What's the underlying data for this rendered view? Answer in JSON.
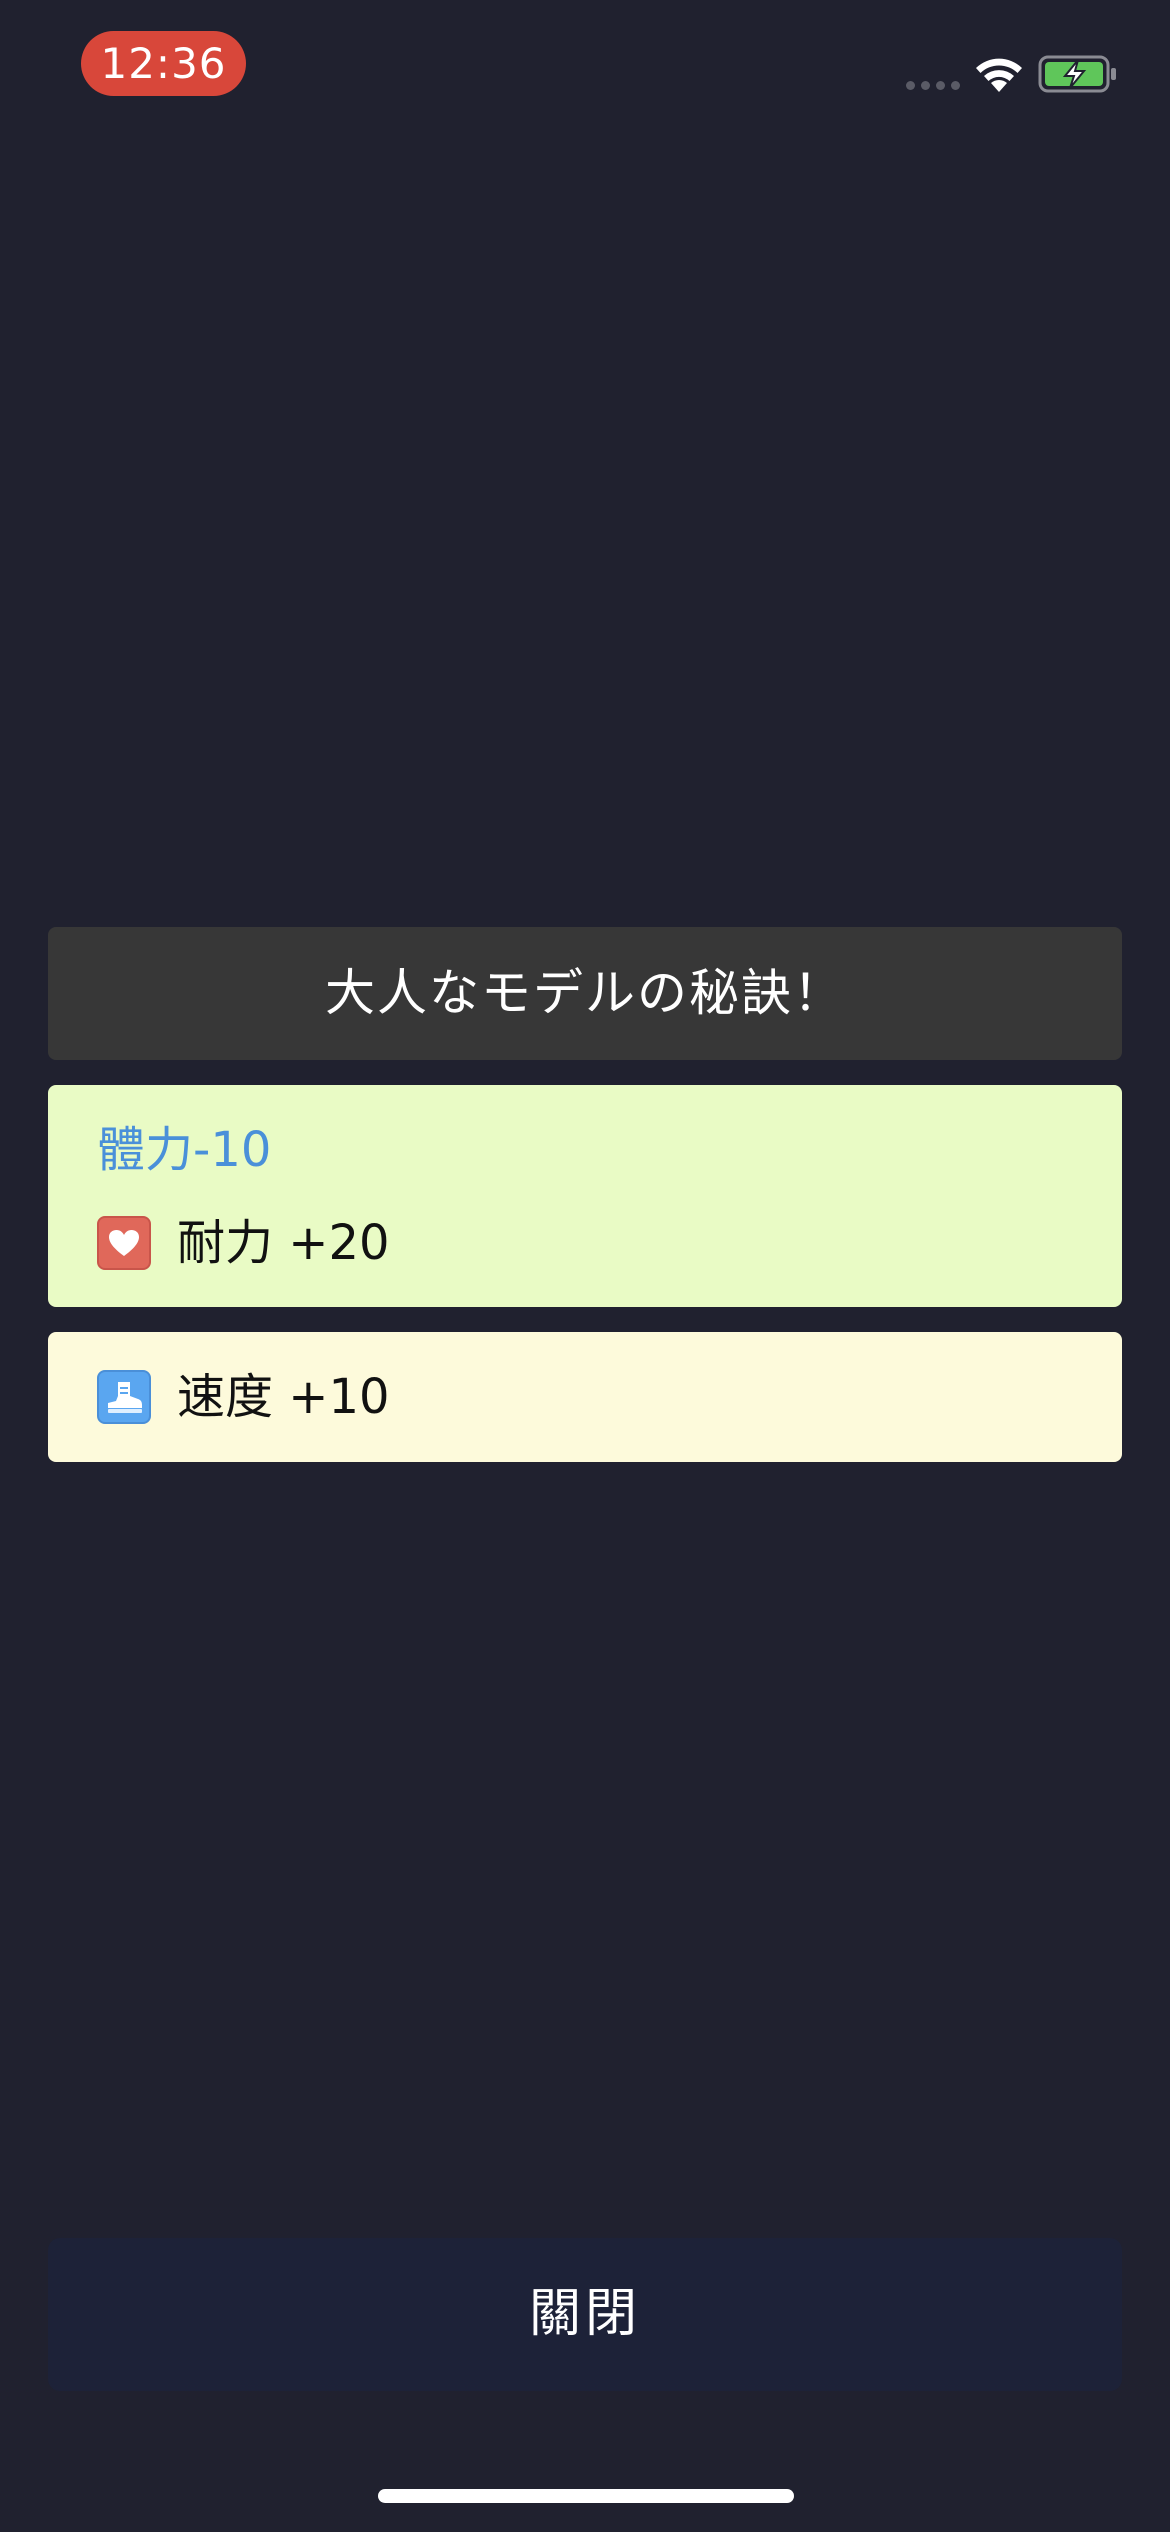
{
  "status_bar": {
    "time": "12:36",
    "icons": [
      "signal-dots-icon",
      "wifi-icon",
      "battery-charging-icon"
    ],
    "colors": {
      "time_pill": "#d8473a",
      "battery": "#5fc65a"
    }
  },
  "dialog": {
    "title": "大人なモデルの秘訣！",
    "cards": [
      {
        "penalty": "體力-10",
        "stat_icon": "heart-icon",
        "stat_label": "耐力 +20",
        "background": "#e9fbc5"
      },
      {
        "stat_icon": "boot-icon",
        "stat_label": "速度 +10",
        "background": "#fdfadb"
      }
    ]
  },
  "close_button": {
    "label": "關閉"
  },
  "colors": {
    "background": "#20212f",
    "title_bar": "#373737",
    "penalty_text": "#4a90d9",
    "close_button": "#1d2238"
  }
}
